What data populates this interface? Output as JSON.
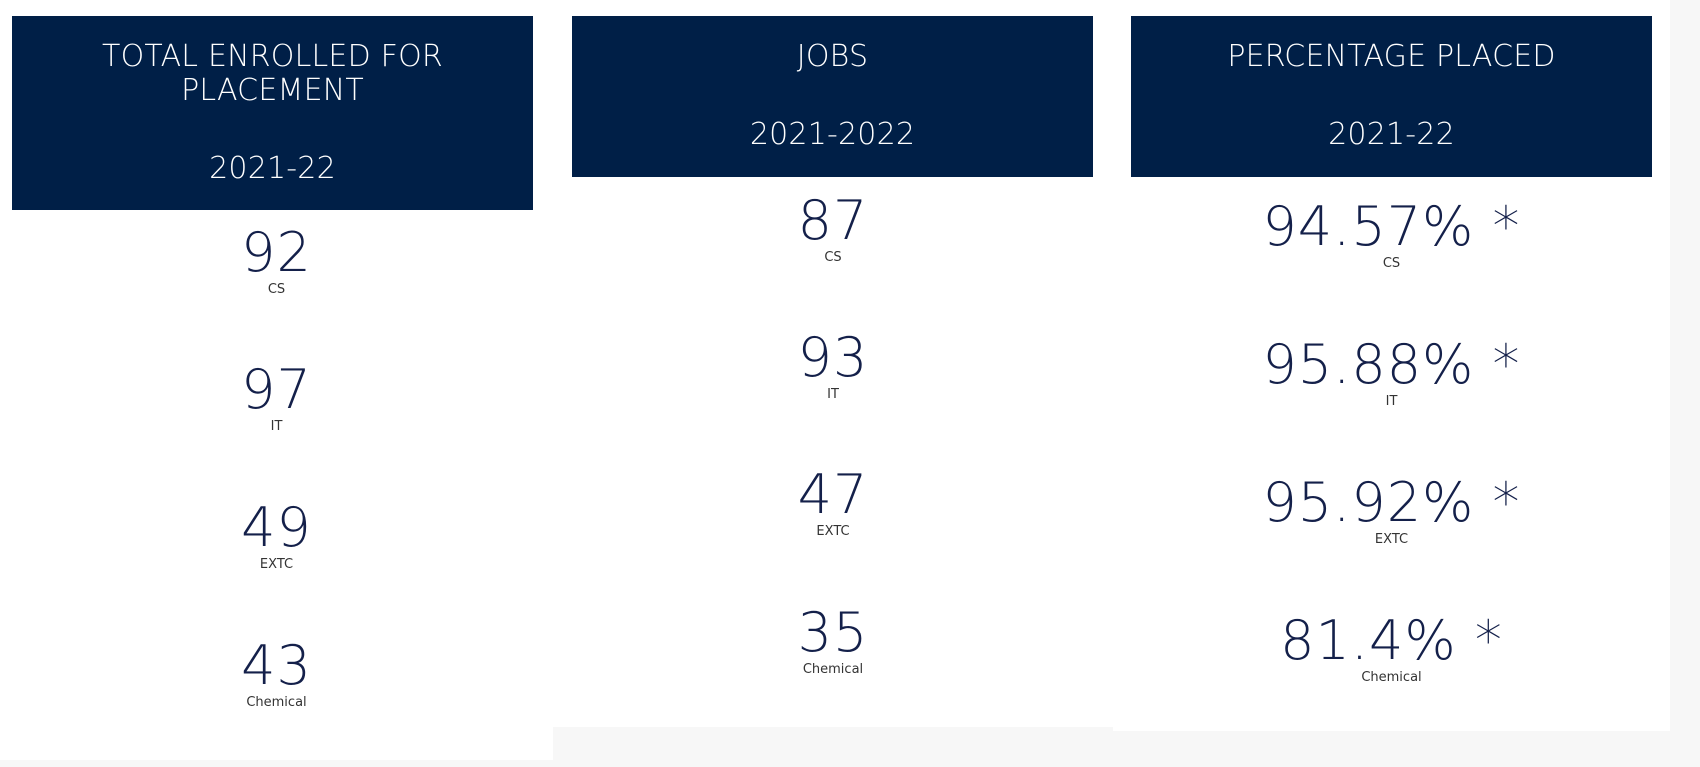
{
  "panels": [
    {
      "title": "TOTAL ENROLLED FOR PLACEMENT",
      "year": "2021-22",
      "stats": [
        {
          "value": "92",
          "label": "CS"
        },
        {
          "value": "97",
          "label": "IT"
        },
        {
          "value": "49",
          "label": "EXTC"
        },
        {
          "value": "43",
          "label": "Chemical"
        }
      ]
    },
    {
      "title": "JOBS",
      "year": "2021-2022",
      "stats": [
        {
          "value": "87",
          "label": "CS"
        },
        {
          "value": "93",
          "label": "IT"
        },
        {
          "value": "47",
          "label": "EXTC"
        },
        {
          "value": "35",
          "label": "Chemical"
        }
      ]
    },
    {
      "title": "PERCENTAGE PLACED",
      "year": "2021-22",
      "stats": [
        {
          "value": "94.57% *",
          "label": "CS"
        },
        {
          "value": "95.88% *",
          "label": "IT"
        },
        {
          "value": "95.92% *",
          "label": "EXTC"
        },
        {
          "value": "81.4% *",
          "label": "Chemical"
        }
      ]
    }
  ],
  "colors": {
    "header_bg": "#001f47",
    "header_text": "#ffffff",
    "value_text": "#14204a",
    "page_bg": "#f7f7f7"
  }
}
